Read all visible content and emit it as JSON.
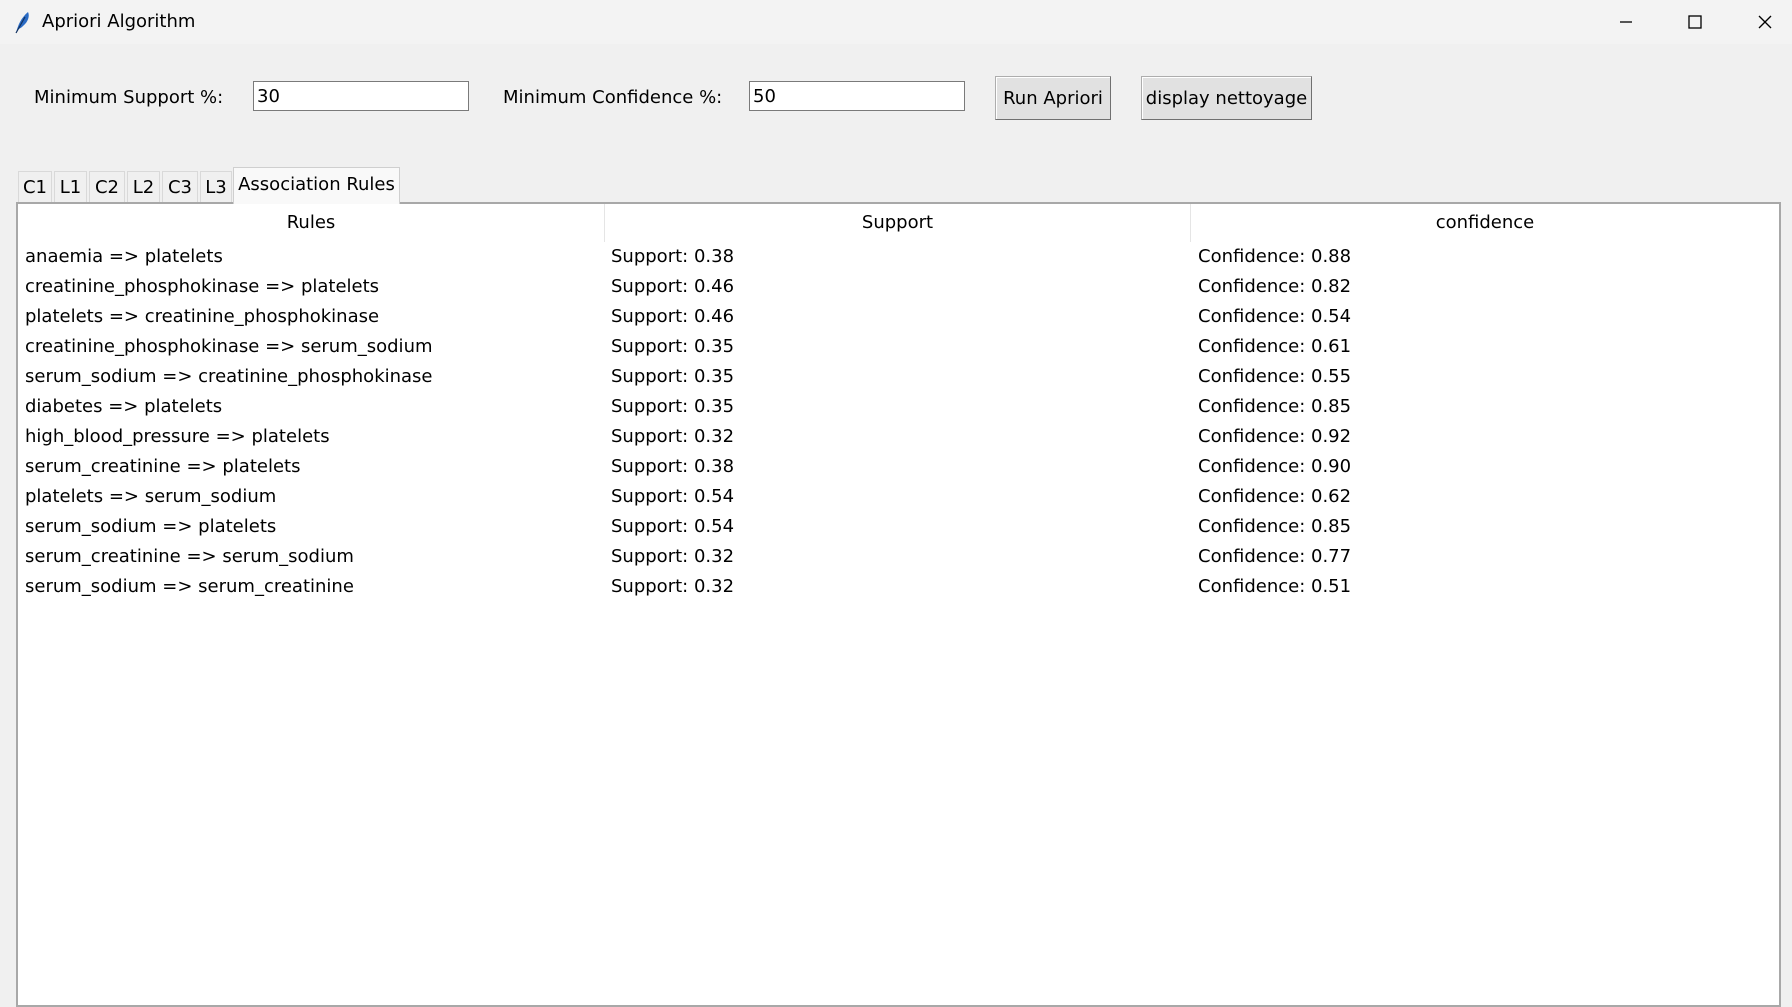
{
  "window": {
    "title": "Apriori Algorithm",
    "app_icon": "feather-icon",
    "controls": [
      "minimize-icon",
      "maximize-icon",
      "close-icon"
    ]
  },
  "controls": {
    "min_support_label": "Minimum Support %:",
    "min_support_value": "30",
    "min_confidence_label": "Minimum Confidence %:",
    "min_confidence_value": "50",
    "run_button": "Run Apriori",
    "display_button": "display nettoyage"
  },
  "tabs": [
    {
      "label": "C1",
      "active": false
    },
    {
      "label": "L1",
      "active": false
    },
    {
      "label": "C2",
      "active": false
    },
    {
      "label": "L2",
      "active": false
    },
    {
      "label": "C3",
      "active": false
    },
    {
      "label": "L3",
      "active": false
    },
    {
      "label": "Association Rules",
      "active": true
    }
  ],
  "table": {
    "columns": [
      "Rules",
      "Support",
      "confidence"
    ],
    "rows": [
      {
        "rule": "anaemia => platelets",
        "support": "Support: 0.38",
        "confidence": "Confidence: 0.88"
      },
      {
        "rule": "creatinine_phosphokinase => platelets",
        "support": "Support: 0.46",
        "confidence": "Confidence: 0.82"
      },
      {
        "rule": "platelets => creatinine_phosphokinase",
        "support": "Support: 0.46",
        "confidence": "Confidence: 0.54"
      },
      {
        "rule": "creatinine_phosphokinase => serum_sodium",
        "support": "Support: 0.35",
        "confidence": "Confidence: 0.61"
      },
      {
        "rule": "serum_sodium => creatinine_phosphokinase",
        "support": "Support: 0.35",
        "confidence": "Confidence: 0.55"
      },
      {
        "rule": "diabetes => platelets",
        "support": "Support: 0.35",
        "confidence": "Confidence: 0.85"
      },
      {
        "rule": "high_blood_pressure => platelets",
        "support": "Support: 0.32",
        "confidence": "Confidence: 0.92"
      },
      {
        "rule": "serum_creatinine => platelets",
        "support": "Support: 0.38",
        "confidence": "Confidence: 0.90"
      },
      {
        "rule": "platelets => serum_sodium",
        "support": "Support: 0.54",
        "confidence": "Confidence: 0.62"
      },
      {
        "rule": "serum_sodium => platelets",
        "support": "Support: 0.54",
        "confidence": "Confidence: 0.85"
      },
      {
        "rule": "serum_creatinine => serum_sodium",
        "support": "Support: 0.32",
        "confidence": "Confidence: 0.77"
      },
      {
        "rule": "serum_sodium => serum_creatinine",
        "support": "Support: 0.32",
        "confidence": "Confidence: 0.51"
      }
    ]
  }
}
